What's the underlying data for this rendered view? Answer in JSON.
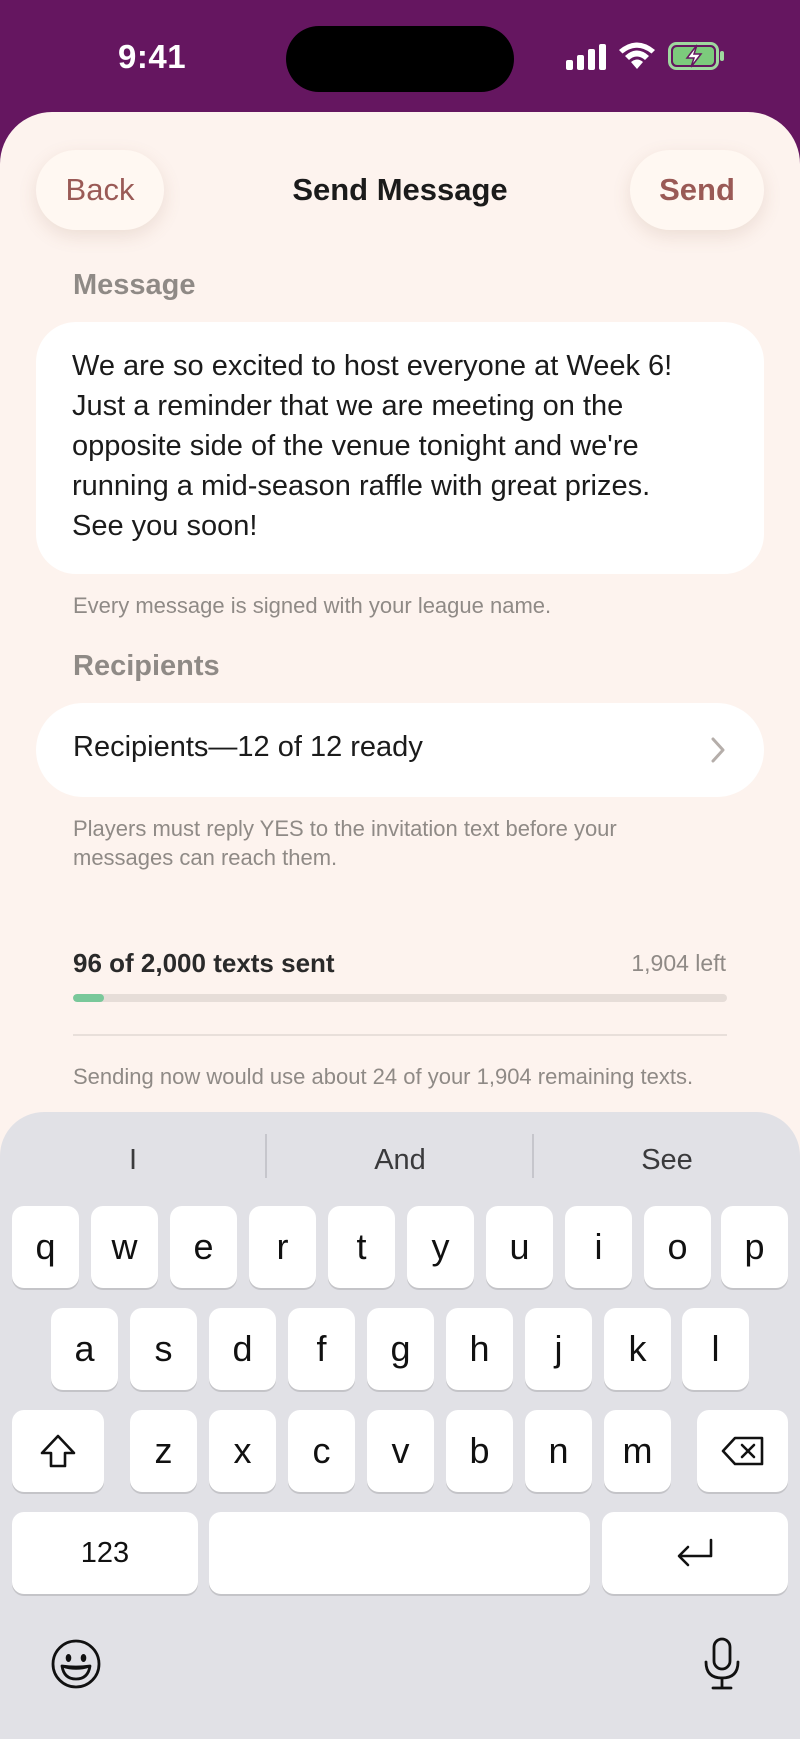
{
  "status": {
    "time": "9:41"
  },
  "nav": {
    "back_label": "Back",
    "title": "Send Message",
    "send_label": "Send"
  },
  "message": {
    "section_label": "Message",
    "lines": [
      "We are so excited to host everyone at Week 6!",
      "Just a reminder that we are meeting on the",
      "opposite side of the venue tonight and we're",
      "running a mid-season raffle with great prizes.",
      "See you soon!"
    ],
    "helper": "Every message is signed with your league name."
  },
  "recipients": {
    "section_label": "Recipients",
    "row_label": "Recipients—12 of 12 ready",
    "helper": "Players must reply YES to the invitation text before your messages can reach them."
  },
  "usage": {
    "label": "96 of 2,000 texts sent",
    "left": "1,904 left",
    "progress_fraction": 0.048,
    "estimate": "Sending now would use about 24 of your 1,904 remaining texts."
  },
  "keyboard": {
    "suggestions": [
      "I",
      "And",
      "See"
    ],
    "row1": [
      "q",
      "w",
      "e",
      "r",
      "t",
      "y",
      "u",
      "i",
      "o",
      "p"
    ],
    "row2": [
      "a",
      "s",
      "d",
      "f",
      "g",
      "h",
      "j",
      "k",
      "l"
    ],
    "row3": [
      "z",
      "x",
      "c",
      "v",
      "b",
      "n",
      "m"
    ],
    "numbers_label": "123"
  },
  "colors": {
    "header": "#651660",
    "sheet": "#fdf3ee",
    "accent": "#9a5a56",
    "progress": "#79c89a"
  }
}
